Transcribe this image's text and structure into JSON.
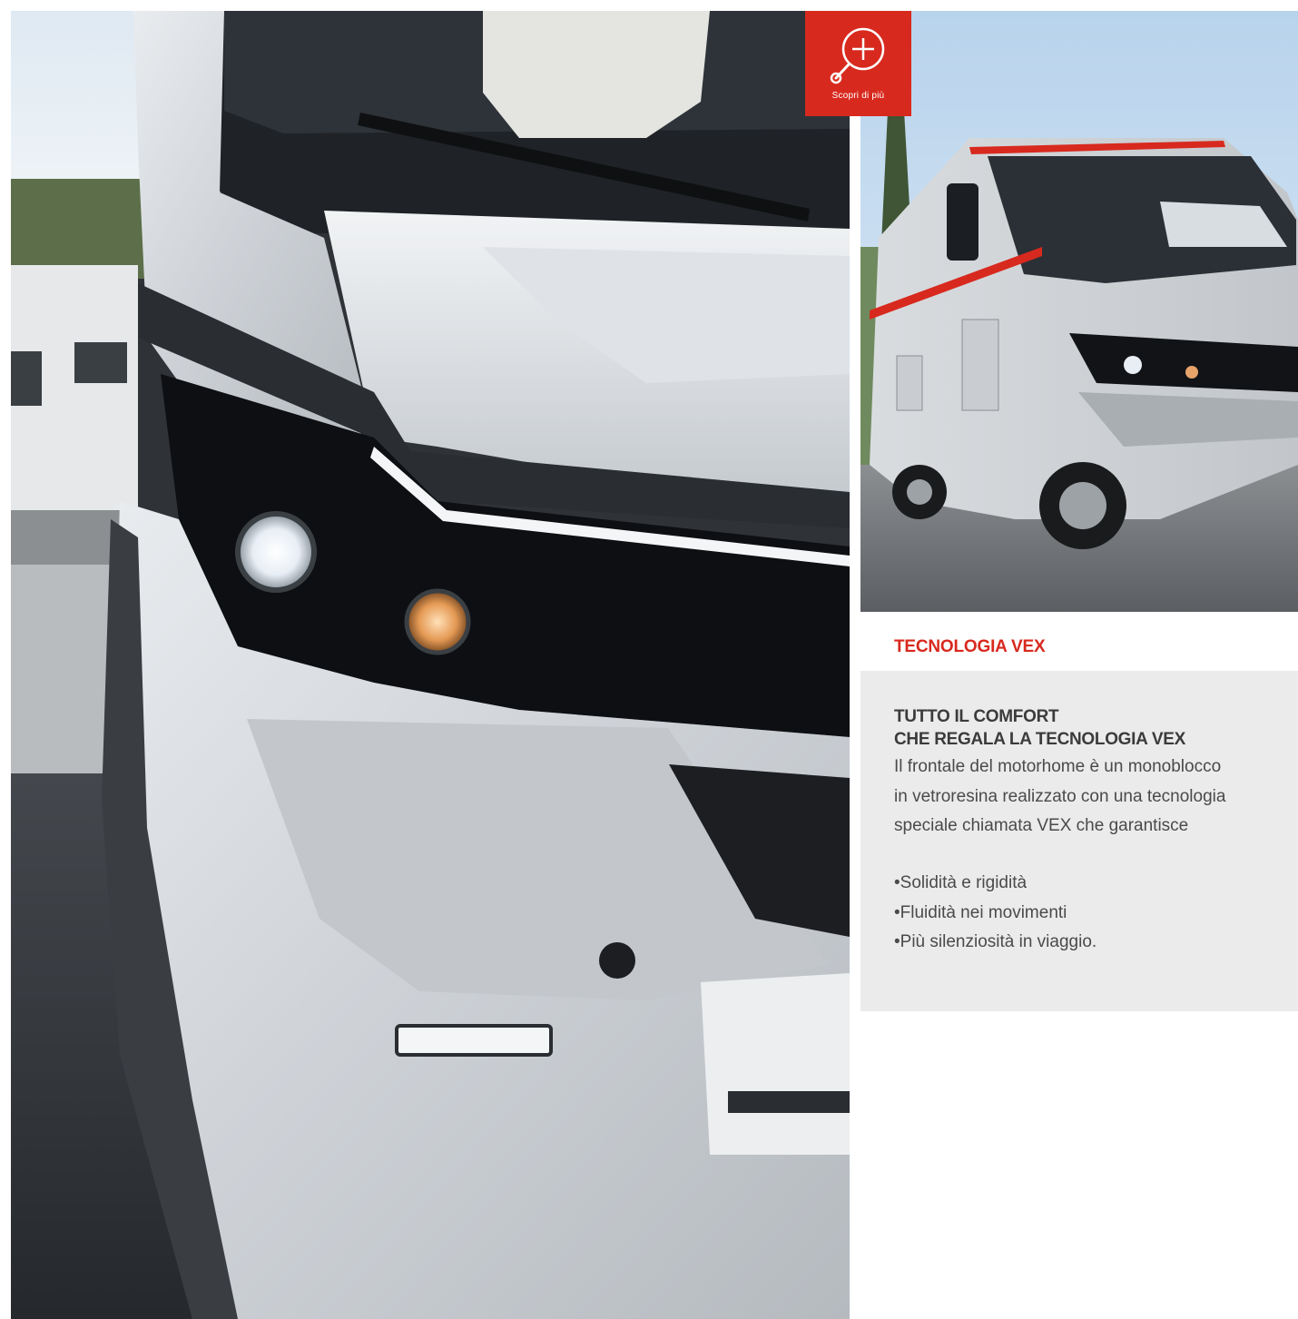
{
  "zoom_badge": {
    "label": "Scopri di più",
    "icon": "zoom-plus-icon",
    "color": "#d8291e"
  },
  "images": {
    "main_photo": "photo-motorhome-front-headlight",
    "side_photo": "photo-motorhome-three-quarter"
  },
  "panel": {
    "tab_title": "TECNOLOGIA VEX",
    "heading_line1": "TUTTO IL COMFORT",
    "heading_line2": "CHE REGALA LA TECNOLOGIA VEX",
    "body_line1": "Il frontale del motorhome è un monoblocco",
    "body_line2": "in vetroresina realizzato con una tecnologia",
    "body_line3": "speciale chiamata VEX che garantisce",
    "features": [
      "Solidità e rigidità",
      "Fluidità nei movimenti",
      "Più silenziosità in viaggio."
    ],
    "accent_color": "#d8291e",
    "background_color": "#ebebeb"
  }
}
